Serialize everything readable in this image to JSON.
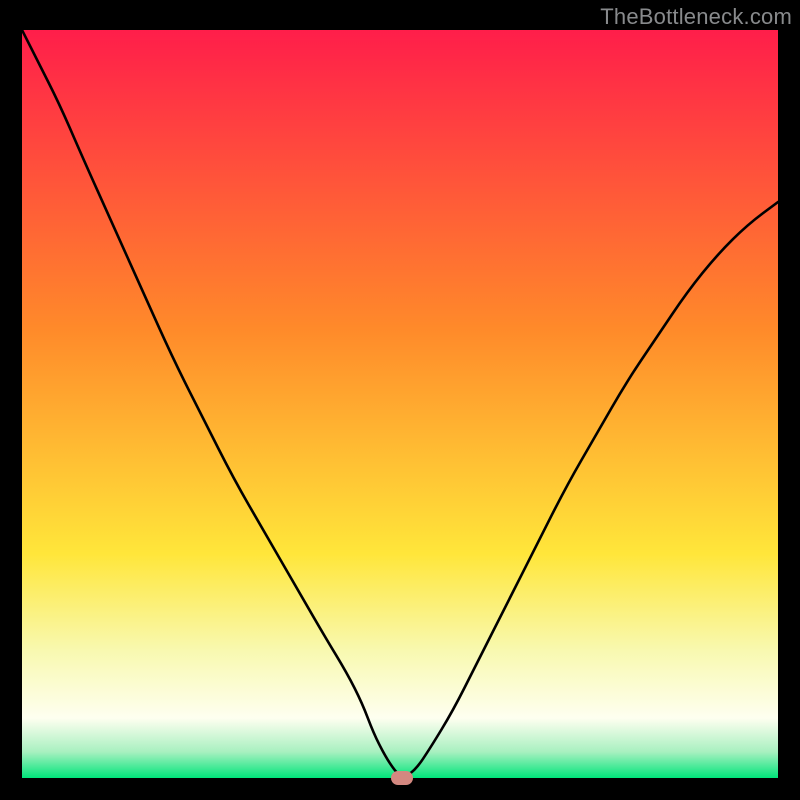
{
  "watermark": {
    "text": "TheBottleneck.com"
  },
  "chart_data": {
    "type": "line",
    "title": "",
    "xlabel": "",
    "ylabel": "",
    "xlim": [
      0,
      100
    ],
    "ylim": [
      0,
      100
    ],
    "grid": false,
    "legend": false,
    "background_gradient": {
      "stops": [
        {
          "offset": 0.0,
          "color": "#ff1e4a"
        },
        {
          "offset": 0.4,
          "color": "#ff8a2a"
        },
        {
          "offset": 0.7,
          "color": "#ffe63a"
        },
        {
          "offset": 0.83,
          "color": "#f8f9b0"
        },
        {
          "offset": 0.92,
          "color": "#fefff0"
        },
        {
          "offset": 0.965,
          "color": "#a8f0c0"
        },
        {
          "offset": 1.0,
          "color": "#00e57a"
        }
      ]
    },
    "series": [
      {
        "name": "bottleneck-curve",
        "color": "#000000",
        "x": [
          0,
          2,
          5,
          8,
          12,
          16,
          20,
          24,
          28,
          32,
          36,
          40,
          43,
          45,
          46.5,
          48,
          49.3,
          50.3,
          52,
          54,
          57,
          60,
          64,
          68,
          72,
          76,
          80,
          84,
          88,
          92,
          96,
          100
        ],
        "y": [
          100,
          96,
          90,
          83,
          74,
          65,
          56,
          48,
          40,
          33,
          26,
          19,
          14,
          10,
          6,
          3,
          1,
          0,
          1,
          4,
          9,
          15,
          23,
          31,
          39,
          46,
          53,
          59,
          65,
          70,
          74,
          77
        ]
      }
    ],
    "marker": {
      "x": 50.3,
      "y": 0,
      "color": "#d48880"
    }
  }
}
